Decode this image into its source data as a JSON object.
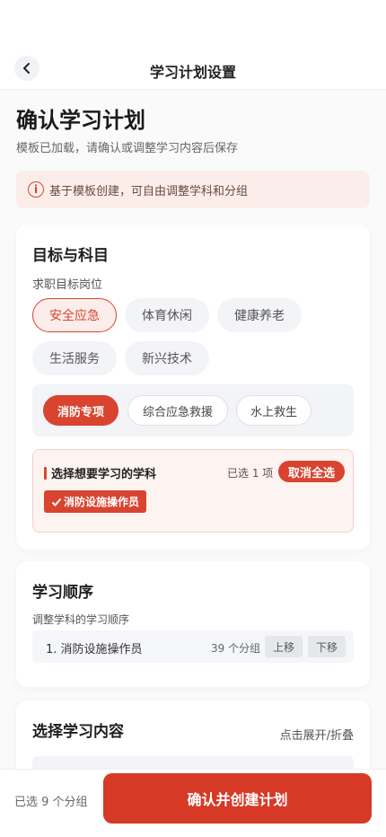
{
  "header": {
    "title": "学习计划设置"
  },
  "page": {
    "title": "确认学习计划",
    "subtitle": "模板已加载，请确认或调整学习内容后保存"
  },
  "notice": {
    "text": "基于模板创建，可自由调整学科和分组"
  },
  "goal": {
    "title": "目标与科目",
    "position_label": "求职目标岗位",
    "positions": [
      "安全应急",
      "体育休闲",
      "健康养老",
      "生活服务",
      "新兴技术"
    ],
    "sub_positions": [
      "消防专项",
      "综合应急救援",
      "水上救生"
    ],
    "subjects": {
      "heading": "选择想要学习的学科",
      "selected_count": "已选 1 项",
      "cancel_label": "取消全选",
      "items": [
        "消防设施操作员"
      ]
    }
  },
  "order": {
    "title": "学习顺序",
    "label": "调整学科的学习顺序",
    "rows": [
      {
        "name": "1. 消防设施操作员",
        "count": "39 个分组",
        "up": "上移",
        "down": "下移"
      }
    ]
  },
  "content": {
    "title": "选择学习内容",
    "toggle": "点击展开/折叠"
  },
  "footer": {
    "selected": "已选 9 个分组",
    "confirm_label": "确认并创建计划"
  },
  "colors": {
    "accent": "#d8442f"
  }
}
